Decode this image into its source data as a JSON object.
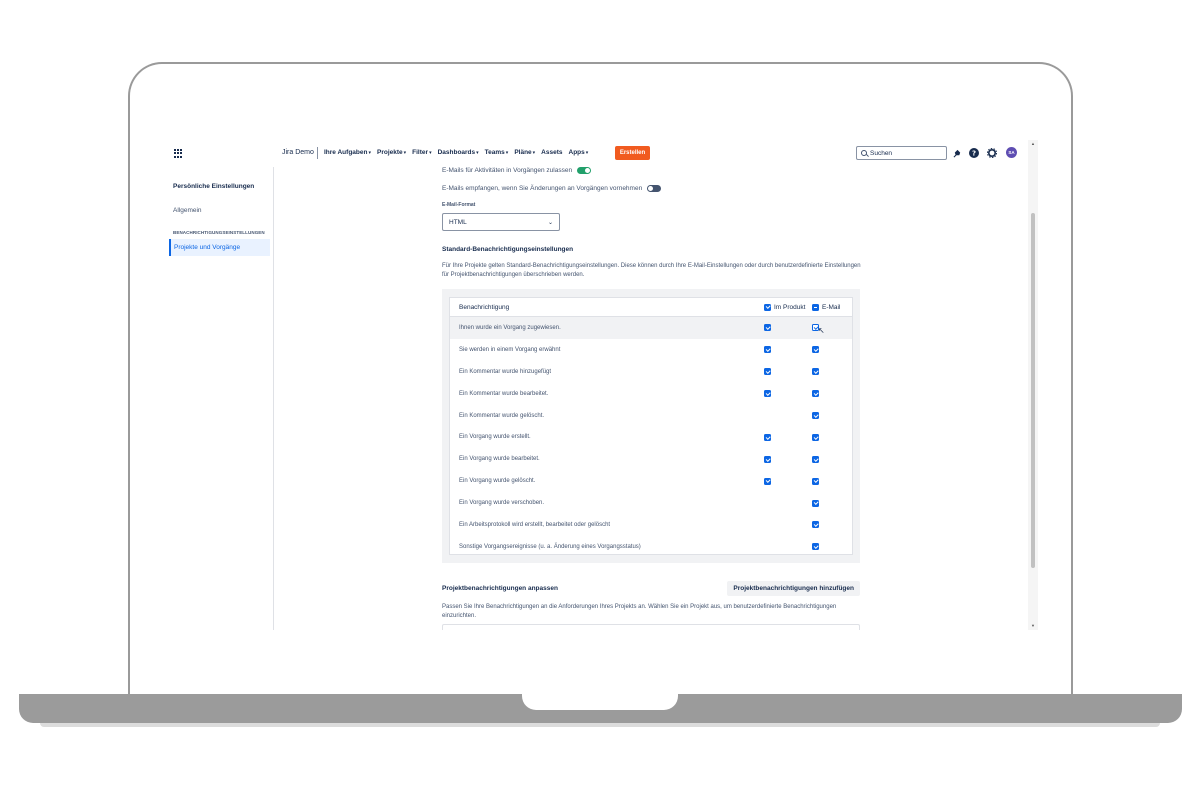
{
  "topnav": {
    "product": "Jira Demo",
    "items": [
      {
        "label": "Ihre Aufgaben",
        "has_menu": true
      },
      {
        "label": "Projekte",
        "has_menu": true
      },
      {
        "label": "Filter",
        "has_menu": true
      },
      {
        "label": "Dashboards",
        "has_menu": true
      },
      {
        "label": "Teams",
        "has_menu": true
      },
      {
        "label": "Pläne",
        "has_menu": true
      },
      {
        "label": "Assets",
        "has_menu": false
      },
      {
        "label": "Apps",
        "has_menu": true
      }
    ],
    "create_label": "Erstellen",
    "search_placeholder": "Suchen",
    "avatar_initials": "SA",
    "accent": "#f15b20"
  },
  "sidebar": {
    "title": "Persönliche Einstellungen",
    "general": "Allgemein",
    "section": "BENACHRICHTIGUNGSEINSTELLUNGEN",
    "active_item": "Projekte und Vorgänge"
  },
  "settings": {
    "toggle1_label": "E-Mails für Aktivitäten in Vorgängen zulassen",
    "toggle1_on": true,
    "toggle2_label": "E-Mails empfangen, wenn Sie Änderungen an Vorgängen vornehmen",
    "toggle2_on": false,
    "format_label": "E-Mail-Format",
    "format_value": "HTML"
  },
  "defaults": {
    "title": "Standard-Benachrichtigungseinstellungen",
    "description": "Für Ihre Projekte gelten Standard-Benachrichtigungseinstellungen. Diese können durch Ihre E-Mail-Einstellungen oder durch benutzerdefinierte Einstellungen für Projektbenachrichtigungen überschrieben werden.",
    "col_notification": "Benachrichtigung",
    "col_product": "Im Produkt",
    "col_email": "E-Mail",
    "rows": [
      {
        "label": "Ihnen wurde ein Vorgang zugewiesen.",
        "product": true,
        "email": true,
        "highlight": true
      },
      {
        "label": "Sie werden in einem Vorgang erwähnt",
        "product": true,
        "email": true
      },
      {
        "label": "Ein Kommentar wurde hinzugefügt",
        "product": true,
        "email": true
      },
      {
        "label": "Ein Kommentar wurde bearbeitet.",
        "product": true,
        "email": true
      },
      {
        "label": "Ein Kommentar wurde gelöscht.",
        "product": false,
        "email": true
      },
      {
        "label": "Ein Vorgang wurde erstellt.",
        "product": true,
        "email": true
      },
      {
        "label": "Ein Vorgang wurde bearbeitet.",
        "product": true,
        "email": true
      },
      {
        "label": "Ein Vorgang wurde gelöscht.",
        "product": true,
        "email": true
      },
      {
        "label": "Ein Vorgang wurde verschoben.",
        "product": false,
        "email": true
      },
      {
        "label": "Ein Arbeitsprotokoll wird erstellt, bearbeitet oder gelöscht",
        "product": false,
        "email": true
      },
      {
        "label": "Sonstige Vorgangsereignisse (u. a. Änderung eines Vorgangsstatus)",
        "product": false,
        "email": true
      }
    ]
  },
  "project": {
    "title": "Projektbenachrichtigungen anpassen",
    "add_button": "Projektbenachrichtigungen hinzufügen",
    "description": "Passen Sie Ihre Benachrichtigungen an die Anforderungen Ihres Projekts an. Wählen Sie ein Projekt aus, um benutzerdefinierte Benachrichtigungen einzurichten."
  }
}
